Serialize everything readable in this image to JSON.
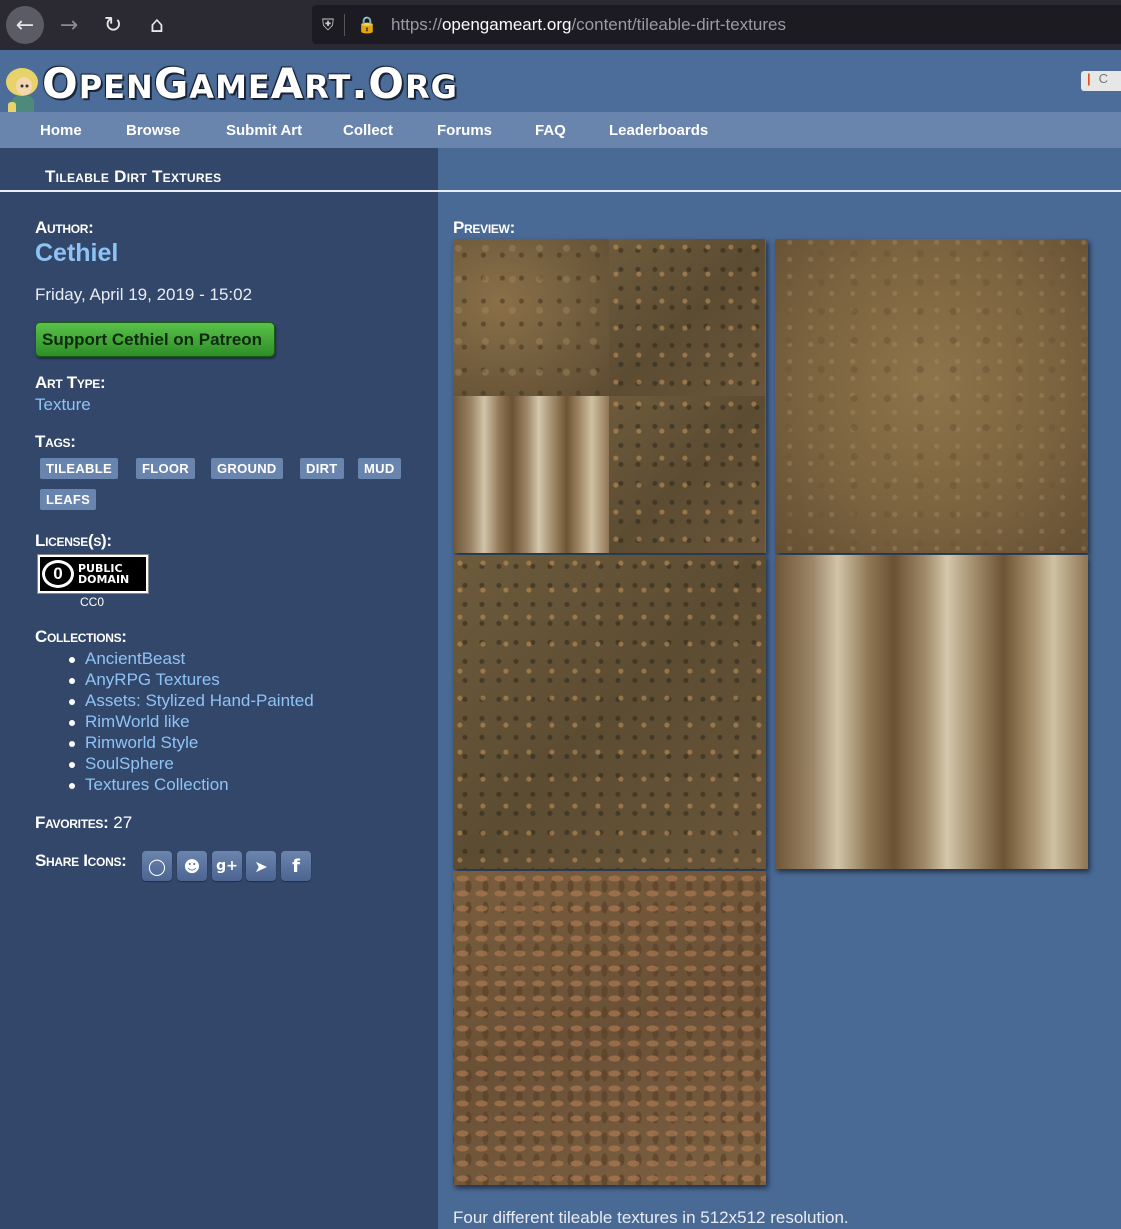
{
  "browser": {
    "url_prefix": "https://",
    "url_domain": "opengameart.org",
    "url_path": "/content/tileable-dirt-textures"
  },
  "site": {
    "logo_text_big1": "O",
    "logo_text_small1": "PEN",
    "logo_text_big2": "G",
    "logo_text_small2": "AME",
    "logo_text_big3": "A",
    "logo_text_small3": "RT",
    "logo_text_dot": ".",
    "logo_text_big4": "O",
    "logo_text_small4": "RG",
    "login_stub": "C"
  },
  "nav": {
    "items": [
      "Home",
      "Browse",
      "Submit Art",
      "Collect",
      "Forums",
      "FAQ",
      "Leaderboards"
    ]
  },
  "page": {
    "title": "Tileable Dirt Textures",
    "author_label": "Author:",
    "author_name": "Cethiel",
    "date": "Friday, April 19, 2019 - 15:02",
    "patreon_button": "Support Cethiel on Patreon",
    "art_type_label": "Art Type:",
    "art_type": "Texture",
    "tags_label": "Tags:",
    "tags": [
      "TILEABLE",
      "FLOOR",
      "GROUND",
      "DIRT",
      "MUD",
      "LEAFS"
    ],
    "license_label": "License(s):",
    "license_badge_line1": "PUBLIC",
    "license_badge_line2": "DOMAIN",
    "license_zero": "0",
    "license_name": "CC0",
    "collections_label": "Collections:",
    "collections": [
      "AncientBeast",
      "AnyRPG Textures",
      "Assets: Stylized Hand-Painted",
      "RimWorld like",
      "Rimworld Style",
      "SoulSphere",
      "Textures Collection"
    ],
    "favorites_label": "Favorites:",
    "favorites_count": "27",
    "share_label": "Share Icons:",
    "share_icons": [
      "qr-code-icon",
      "reddit-icon",
      "google-plus-icon",
      "twitter-icon",
      "facebook-icon"
    ],
    "preview_label": "Preview:",
    "caption": "Four different tileable textures in 512x512 resolution."
  }
}
